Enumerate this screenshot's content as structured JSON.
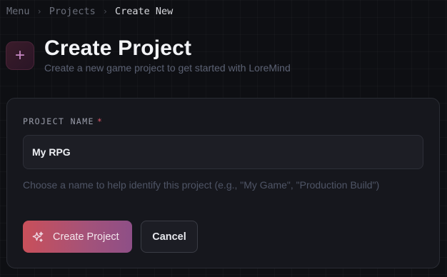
{
  "breadcrumb": {
    "items": [
      "Menu",
      "Projects",
      "Create New"
    ],
    "separator": "›"
  },
  "header": {
    "icon": "plus-icon",
    "icon_glyph": "+",
    "title": "Create Project",
    "subtitle": "Create a new game project to get started with LoreMind"
  },
  "form": {
    "project_name": {
      "label": "PROJECT NAME",
      "required_marker": "*",
      "value": "My RPG",
      "help_text": "Choose a name to help identify this project (e.g., \"My Game\", \"Production Build\")"
    },
    "create_button": {
      "label": "Create Project",
      "icon": "sparkles-icon"
    },
    "cancel_button": {
      "label": "Cancel"
    }
  },
  "colors": {
    "background": "#0e0f13",
    "card": "#16171d",
    "accent_start": "#c9505a",
    "accent_end": "#8e4f87",
    "required": "#e05a6b"
  }
}
